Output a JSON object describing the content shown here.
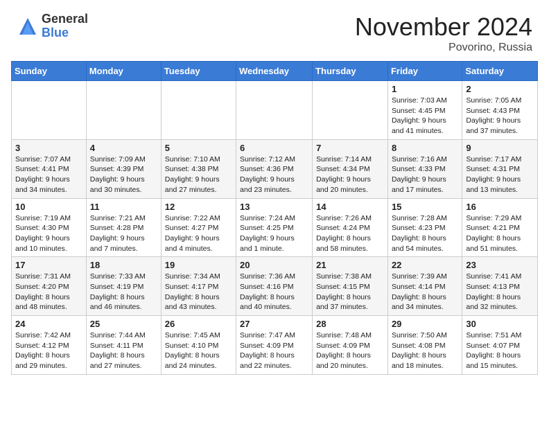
{
  "header": {
    "logo_general": "General",
    "logo_blue": "Blue",
    "month_title": "November 2024",
    "location": "Povorino, Russia"
  },
  "weekdays": [
    "Sunday",
    "Monday",
    "Tuesday",
    "Wednesday",
    "Thursday",
    "Friday",
    "Saturday"
  ],
  "weeks": [
    [
      {
        "day": "",
        "info": ""
      },
      {
        "day": "",
        "info": ""
      },
      {
        "day": "",
        "info": ""
      },
      {
        "day": "",
        "info": ""
      },
      {
        "day": "",
        "info": ""
      },
      {
        "day": "1",
        "info": "Sunrise: 7:03 AM\nSunset: 4:45 PM\nDaylight: 9 hours\nand 41 minutes."
      },
      {
        "day": "2",
        "info": "Sunrise: 7:05 AM\nSunset: 4:43 PM\nDaylight: 9 hours\nand 37 minutes."
      }
    ],
    [
      {
        "day": "3",
        "info": "Sunrise: 7:07 AM\nSunset: 4:41 PM\nDaylight: 9 hours\nand 34 minutes."
      },
      {
        "day": "4",
        "info": "Sunrise: 7:09 AM\nSunset: 4:39 PM\nDaylight: 9 hours\nand 30 minutes."
      },
      {
        "day": "5",
        "info": "Sunrise: 7:10 AM\nSunset: 4:38 PM\nDaylight: 9 hours\nand 27 minutes."
      },
      {
        "day": "6",
        "info": "Sunrise: 7:12 AM\nSunset: 4:36 PM\nDaylight: 9 hours\nand 23 minutes."
      },
      {
        "day": "7",
        "info": "Sunrise: 7:14 AM\nSunset: 4:34 PM\nDaylight: 9 hours\nand 20 minutes."
      },
      {
        "day": "8",
        "info": "Sunrise: 7:16 AM\nSunset: 4:33 PM\nDaylight: 9 hours\nand 17 minutes."
      },
      {
        "day": "9",
        "info": "Sunrise: 7:17 AM\nSunset: 4:31 PM\nDaylight: 9 hours\nand 13 minutes."
      }
    ],
    [
      {
        "day": "10",
        "info": "Sunrise: 7:19 AM\nSunset: 4:30 PM\nDaylight: 9 hours\nand 10 minutes."
      },
      {
        "day": "11",
        "info": "Sunrise: 7:21 AM\nSunset: 4:28 PM\nDaylight: 9 hours\nand 7 minutes."
      },
      {
        "day": "12",
        "info": "Sunrise: 7:22 AM\nSunset: 4:27 PM\nDaylight: 9 hours\nand 4 minutes."
      },
      {
        "day": "13",
        "info": "Sunrise: 7:24 AM\nSunset: 4:25 PM\nDaylight: 9 hours\nand 1 minute."
      },
      {
        "day": "14",
        "info": "Sunrise: 7:26 AM\nSunset: 4:24 PM\nDaylight: 8 hours\nand 58 minutes."
      },
      {
        "day": "15",
        "info": "Sunrise: 7:28 AM\nSunset: 4:23 PM\nDaylight: 8 hours\nand 54 minutes."
      },
      {
        "day": "16",
        "info": "Sunrise: 7:29 AM\nSunset: 4:21 PM\nDaylight: 8 hours\nand 51 minutes."
      }
    ],
    [
      {
        "day": "17",
        "info": "Sunrise: 7:31 AM\nSunset: 4:20 PM\nDaylight: 8 hours\nand 48 minutes."
      },
      {
        "day": "18",
        "info": "Sunrise: 7:33 AM\nSunset: 4:19 PM\nDaylight: 8 hours\nand 46 minutes."
      },
      {
        "day": "19",
        "info": "Sunrise: 7:34 AM\nSunset: 4:17 PM\nDaylight: 8 hours\nand 43 minutes."
      },
      {
        "day": "20",
        "info": "Sunrise: 7:36 AM\nSunset: 4:16 PM\nDaylight: 8 hours\nand 40 minutes."
      },
      {
        "day": "21",
        "info": "Sunrise: 7:38 AM\nSunset: 4:15 PM\nDaylight: 8 hours\nand 37 minutes."
      },
      {
        "day": "22",
        "info": "Sunrise: 7:39 AM\nSunset: 4:14 PM\nDaylight: 8 hours\nand 34 minutes."
      },
      {
        "day": "23",
        "info": "Sunrise: 7:41 AM\nSunset: 4:13 PM\nDaylight: 8 hours\nand 32 minutes."
      }
    ],
    [
      {
        "day": "24",
        "info": "Sunrise: 7:42 AM\nSunset: 4:12 PM\nDaylight: 8 hours\nand 29 minutes."
      },
      {
        "day": "25",
        "info": "Sunrise: 7:44 AM\nSunset: 4:11 PM\nDaylight: 8 hours\nand 27 minutes."
      },
      {
        "day": "26",
        "info": "Sunrise: 7:45 AM\nSunset: 4:10 PM\nDaylight: 8 hours\nand 24 minutes."
      },
      {
        "day": "27",
        "info": "Sunrise: 7:47 AM\nSunset: 4:09 PM\nDaylight: 8 hours\nand 22 minutes."
      },
      {
        "day": "28",
        "info": "Sunrise: 7:48 AM\nSunset: 4:09 PM\nDaylight: 8 hours\nand 20 minutes."
      },
      {
        "day": "29",
        "info": "Sunrise: 7:50 AM\nSunset: 4:08 PM\nDaylight: 8 hours\nand 18 minutes."
      },
      {
        "day": "30",
        "info": "Sunrise: 7:51 AM\nSunset: 4:07 PM\nDaylight: 8 hours\nand 15 minutes."
      }
    ]
  ]
}
